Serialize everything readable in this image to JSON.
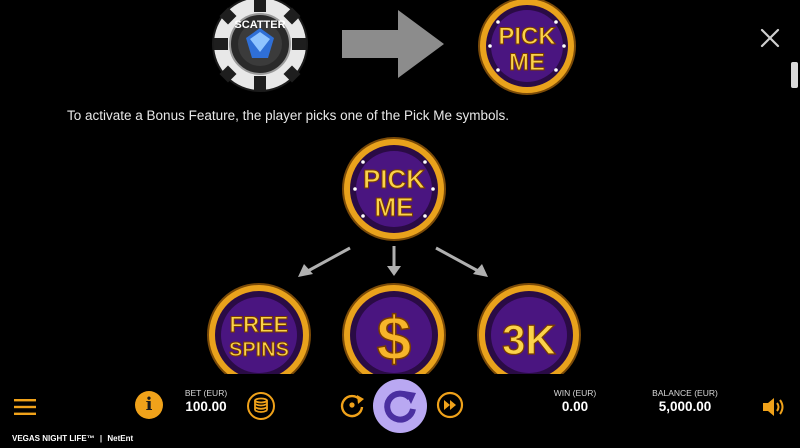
{
  "help": {
    "caption": "To activate a Bonus Feature, the player picks one of the Pick Me symbols.",
    "scatter_text": "SCATTER",
    "pick_line1": "PICK",
    "pick_line2": "ME",
    "free_line1": "FREE",
    "free_line2": "SPINS",
    "dollar": "$",
    "cash": "3K"
  },
  "bar": {
    "bet_label": "BET (EUR)",
    "bet_value": "100.00",
    "win_label": "WIN (EUR)",
    "win_value": "0.00",
    "balance_label": "BALANCE (EUR)",
    "balance_value": "5,000.00",
    "info_glyph": "i"
  },
  "footer": {
    "game_name": "VEGAS NIGHT LIFE™",
    "separator": "|",
    "brand": "NetEnt"
  },
  "colors": {
    "background": "#000000",
    "gold": "#e9a21c",
    "purple": "#4a1580",
    "spin_button": "#b9a8f2",
    "info_button": "#f0a21a"
  }
}
